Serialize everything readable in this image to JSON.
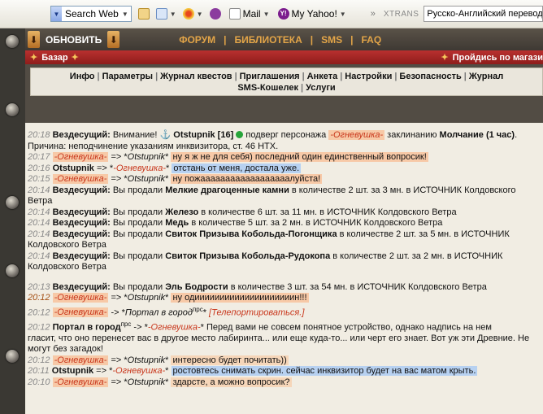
{
  "colors": {
    "orange_highlight": "#f7c9a7",
    "blue_highlight": "#b7d1f1",
    "peach_highlight": "#f6d6b9",
    "dark_red_bar": "#9e2321",
    "gold_menu": "#e3a548"
  },
  "ie_toolbar": {
    "search_label": "Search Web",
    "mail_label": "Mail",
    "yahoo_label": "My Yahoo!",
    "xtrans_label": "XTRANS",
    "translate_field": "Русско-Английский перевод",
    "icons": [
      "search-dropdown-icon",
      "pencil-icon",
      "favorites-icon",
      "target-icon",
      "audio-icon",
      "mail-icon",
      "yahoo-icon",
      "chevron-right-icon"
    ]
  },
  "game_top": {
    "update_label": "ОБНОВИТЬ",
    "menu": [
      "ФОРУМ",
      "БИБЛИОТЕКА",
      "SMS",
      "FAQ"
    ],
    "menu_sep": "|"
  },
  "red_bar": {
    "left": "Базар",
    "right": "Пройдись по магази"
  },
  "nav": {
    "items": [
      "Инфо",
      "Параметры",
      "Журнал квестов",
      "Приглашения",
      "Анкета",
      "Настройки",
      "Безопасность",
      "Журнал",
      "SMS-Кошелек",
      "Услуги"
    ],
    "sep": "|"
  },
  "chat": {
    "lines": [
      {
        "time": "20:18",
        "parts": [
          {
            "text": "Вездесущий: ",
            "bold": true
          },
          {
            "text": "Внимание! "
          },
          {
            "text": "⚓ ",
            "icon": "anchor-icon"
          },
          {
            "text": "Otstupnik [16] ",
            "bold": true
          },
          {
            "text": "",
            "icon": "online-icon"
          },
          {
            "text": " подверг персонажа "
          },
          {
            "text": "-Огневушка-",
            "red": true,
            "bg": "#f7c9a7"
          },
          {
            "text": " заклинанию "
          },
          {
            "text": "Молчание (1 час)",
            "bold": true
          },
          {
            "text": "."
          }
        ]
      },
      {
        "time": "",
        "parts": [
          {
            "text": "Причина: неподчинение указаниям инквизитора, ст. 46 НТХ."
          }
        ]
      },
      {
        "time": "20:17",
        "parts": [
          {
            "text": "-Огневушка-",
            "red": true,
            "bg": "#f7c9a7"
          },
          {
            "text": " => *"
          },
          {
            "text": "Otstupnik",
            "it": true
          },
          {
            "text": "* "
          },
          {
            "text": "ну я ж не для себя) последний один единственный вопросик!",
            "bg": "#f7c9a7"
          }
        ]
      },
      {
        "time": "20:16",
        "parts": [
          {
            "text": "Otstupnik",
            "bold": true
          },
          {
            "text": " => *"
          },
          {
            "text": "-Огневушка-",
            "red": true
          },
          {
            "text": "* "
          },
          {
            "text": "отстань от меня, достала уже.",
            "bg": "#b7d1f1"
          }
        ]
      },
      {
        "time": "20:15",
        "parts": [
          {
            "text": "-Огневушка-",
            "red": true,
            "bg": "#f7c9a7"
          },
          {
            "text": " => *"
          },
          {
            "text": "Otstupnik",
            "it": true
          },
          {
            "text": "* "
          },
          {
            "text": "ну пожаааааааааааааааааалуйста!",
            "bg": "#f7c9a7"
          }
        ]
      },
      {
        "time": "20:14",
        "parts": [
          {
            "text": "Вездесущий: ",
            "bold": true
          },
          {
            "text": "Вы продали "
          },
          {
            "text": "Мелкие драгоценные камни",
            "bold": true
          },
          {
            "text": " в количестве 2 шт. за 3 мн. в ИСТОЧНИК Колдовского"
          }
        ]
      },
      {
        "time": "",
        "parts": [
          {
            "text": "Ветра"
          }
        ]
      },
      {
        "time": "20:14",
        "parts": [
          {
            "text": "Вездесущий: ",
            "bold": true
          },
          {
            "text": "Вы продали "
          },
          {
            "text": "Железо",
            "bold": true
          },
          {
            "text": " в количестве 6 шт. за 11 мн. в ИСТОЧНИК Колдовского Ветра"
          }
        ]
      },
      {
        "time": "20:14",
        "parts": [
          {
            "text": "Вездесущий: ",
            "bold": true
          },
          {
            "text": "Вы продали "
          },
          {
            "text": "Медь",
            "bold": true
          },
          {
            "text": " в количестве 5 шт. за 2 мн. в ИСТОЧНИК Колдовского Ветра"
          }
        ]
      },
      {
        "time": "20:14",
        "parts": [
          {
            "text": "Вездесущий: ",
            "bold": true
          },
          {
            "text": "Вы продали "
          },
          {
            "text": "Свиток Призыва Кобольда-Погонщика",
            "bold": true
          },
          {
            "text": " в количестве 2 шт. за 5 мн. в ИСТОЧНИК"
          }
        ]
      },
      {
        "time": "",
        "parts": [
          {
            "text": "Колдовского Ветра"
          }
        ]
      },
      {
        "time": "20:14",
        "parts": [
          {
            "text": "Вездесущий: ",
            "bold": true
          },
          {
            "text": "Вы продали "
          },
          {
            "text": "Свиток Призыва Кобольда-Рудокопа",
            "bold": true
          },
          {
            "text": " в количестве 2 шт. за 2 мн. в ИСТОЧНИК"
          }
        ]
      },
      {
        "time": "",
        "parts": [
          {
            "text": "Колдовского Ветра"
          }
        ]
      },
      {
        "gap": true
      },
      {
        "time": "20:13",
        "parts": [
          {
            "text": "Вездесущий: ",
            "bold": true
          },
          {
            "text": "Вы продали "
          },
          {
            "text": "Эль Бодрости",
            "bold": true
          },
          {
            "text": " в количестве 3 шт. за 54 мн. в ИСТОЧНИК Колдовского Ветра"
          }
        ]
      },
      {
        "time": "20:12",
        "hlTime": true,
        "parts": [
          {
            "text": "-Огневушка-",
            "red": true,
            "bg": "#f7c9a7"
          },
          {
            "text": " => *"
          },
          {
            "text": "Otstupnik",
            "it": true
          },
          {
            "text": "* "
          },
          {
            "text": "ну одиииииииииииииииииииин!!!",
            "bg": "#f7c9a7"
          }
        ]
      },
      {
        "time": "20:12",
        "parts": [
          {
            "text": "-Огневушка-",
            "red": true,
            "bg": "#f7c9a7"
          },
          {
            "text": " -> *"
          },
          {
            "text": "Портал в город",
            "it": true
          },
          {
            "text": "прс",
            "sup": true
          },
          {
            "text": "* "
          },
          {
            "text": "[Телепортироваться.]",
            "red": true
          }
        ]
      },
      {
        "time": "20:12",
        "parts": [
          {
            "text": "Портал в город",
            "bold": true
          },
          {
            "text": "прс",
            "sup": true
          },
          {
            "text": " -> *"
          },
          {
            "text": "-Огневушка-",
            "red": true
          },
          {
            "text": "* Перед вами не совсем понятное устройство, однако надпись на нем"
          }
        ]
      },
      {
        "time": "",
        "parts": [
          {
            "text": "гласит, что оно перенесет вас в другое место лабиринта... или еще куда-то... или черт его знает. Вот уж эти Древние. Не"
          }
        ]
      },
      {
        "time": "",
        "parts": [
          {
            "text": "могут без загадок!"
          }
        ]
      },
      {
        "time": "20:12",
        "parts": [
          {
            "text": "-Огневушка-",
            "red": true,
            "bg": "#f7c9a7"
          },
          {
            "text": " => *"
          },
          {
            "text": "Otstupnik",
            "it": true
          },
          {
            "text": "* "
          },
          {
            "text": "интересно будет почитать))",
            "bg": "#f6d6b9"
          }
        ]
      },
      {
        "time": "20:11",
        "parts": [
          {
            "text": "Otstupnik",
            "bold": true
          },
          {
            "text": " => *"
          },
          {
            "text": "-Огневушка-",
            "red": true
          },
          {
            "text": "* "
          },
          {
            "text": "ростовтесь снимать скрин. сейчас инквизитор будет на вас матом крыть.",
            "bg": "#b7d1f1"
          }
        ]
      },
      {
        "time": "20:10",
        "parts": [
          {
            "text": "-Огневушка-",
            "red": true,
            "bg": "#f7c9a7"
          },
          {
            "text": " => *"
          },
          {
            "text": "Otstupnik",
            "it": true
          },
          {
            "text": "* "
          },
          {
            "text": "здарсте, а можно вопросик?",
            "bg": "#f6d6b9"
          }
        ]
      }
    ]
  }
}
